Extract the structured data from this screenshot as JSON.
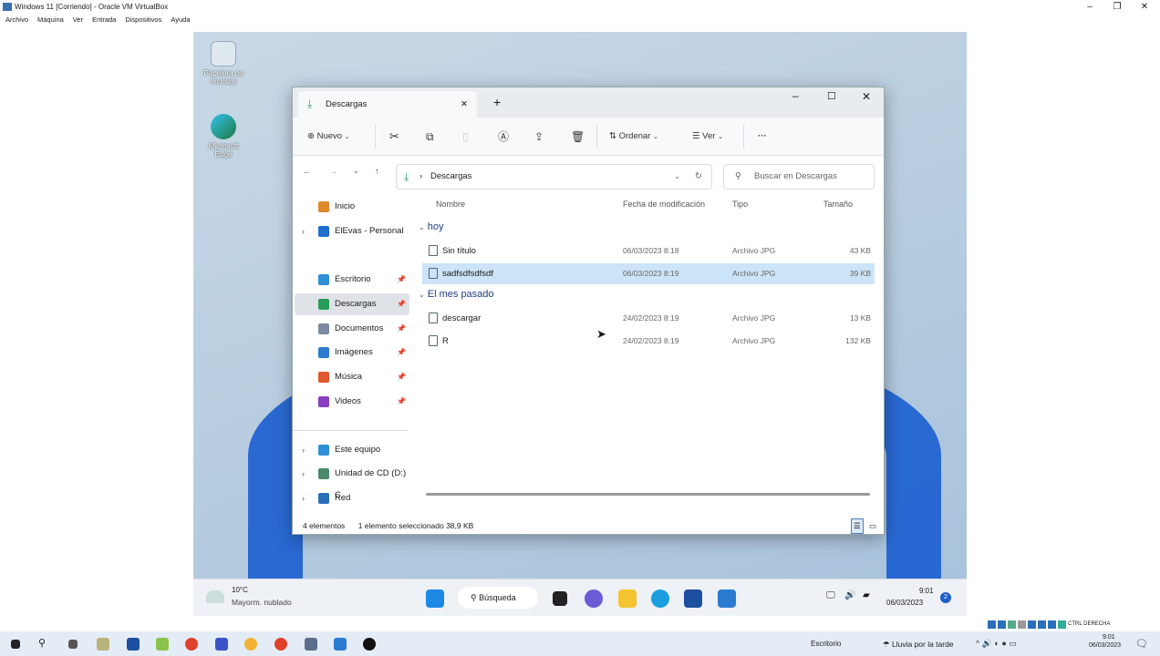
{
  "vbox": {
    "title": "Windows 11 [Corriendo] - Oracle VM VirtualBox",
    "menu": [
      "Archivo",
      "Máquina",
      "Ver",
      "Entrada",
      "Dispositivos",
      "Ayuda"
    ],
    "host_key": "CTRL DERECHA"
  },
  "desktop": {
    "icons": [
      "Papelera de reciclaje",
      "Microsoft Edge"
    ]
  },
  "explorer": {
    "tab": "Descargas",
    "new_tab": "+",
    "toolbar": {
      "new": "Nuevo",
      "sort": "Ordenar",
      "view": "Ver",
      "more": "···"
    },
    "address": "Descargas",
    "search_placeholder": "Buscar en Descargas",
    "sidebar": [
      {
        "label": "Inicio",
        "color": "#e08a2c"
      },
      {
        "label": "ElEvas - Personal",
        "color": "#1f6fd0",
        "chev": true
      },
      {
        "label": "Escritorio",
        "color": "#2f8fd8",
        "pin": true
      },
      {
        "label": "Descargas",
        "color": "#2a9d5a",
        "pin": true,
        "selected": true
      },
      {
        "label": "Documentos",
        "color": "#7d8aa0",
        "pin": true
      },
      {
        "label": "Imágenes",
        "color": "#2b7bd0",
        "pin": true
      },
      {
        "label": "Música",
        "color": "#e0582c",
        "pin": true
      },
      {
        "label": "Videos",
        "color": "#8a3fc0",
        "pin": true
      },
      {
        "label": "Este equipo",
        "color": "#2f8fd8",
        "chev": true
      },
      {
        "label": "Unidad de CD (D:) C",
        "color": "#4a8a6a",
        "chev": true
      },
      {
        "label": "Red",
        "color": "#2b6fb8",
        "chev": true
      }
    ],
    "columns": {
      "name": "Nombre",
      "date": "Fecha de modificación",
      "type": "Tipo",
      "size": "Tamaño"
    },
    "groups": [
      {
        "label": "hoy",
        "files": [
          {
            "name": "Sin título",
            "date": "06/03/2023 8:18",
            "type": "Archivo JPG",
            "size": "43 KB"
          },
          {
            "name": "sadfsdfsdfsdf",
            "date": "06/03/2023 8:19",
            "type": "Archivo JPG",
            "size": "39 KB",
            "selected": true
          }
        ]
      },
      {
        "label": "El mes pasado",
        "files": [
          {
            "name": "descargar",
            "date": "24/02/2023 8:19",
            "type": "Archivo JPG",
            "size": "13 KB"
          },
          {
            "name": "R",
            "date": "24/02/2023 8:19",
            "type": "Archivo JPG",
            "size": "132 KB"
          }
        ]
      }
    ],
    "status": {
      "count": "4 elementos",
      "selected": "1 elemento seleccionado  38,9 KB"
    }
  },
  "vm_taskbar": {
    "temp": "10°C",
    "weather": "Mayorm. nublado",
    "search": "Búsqueda",
    "time": "9:01",
    "date": "06/03/2023",
    "badge": "2"
  },
  "host_taskbar": {
    "desktop": "Escritorio",
    "weather": "Lluvia por la tarde",
    "time": "9:01",
    "date": "06/03/2023"
  }
}
